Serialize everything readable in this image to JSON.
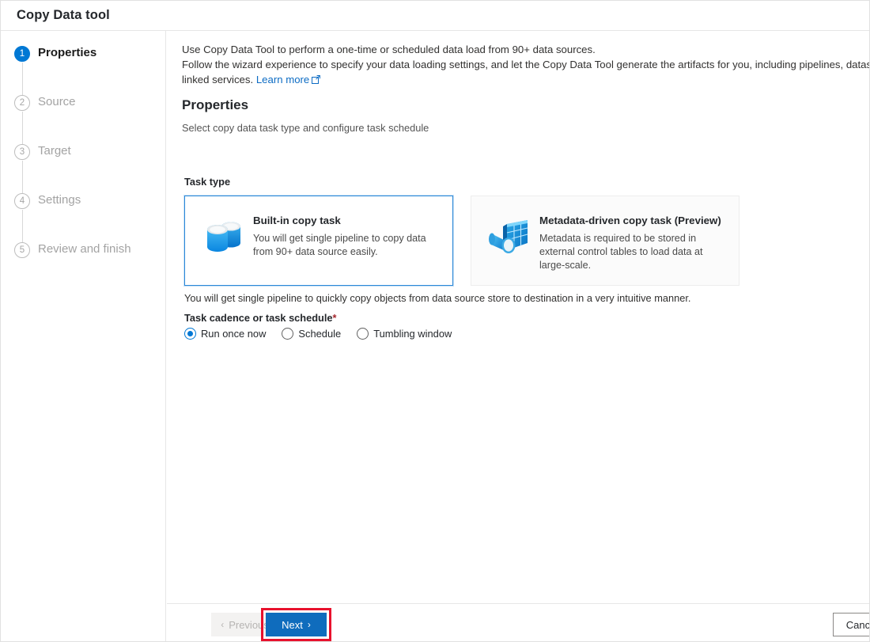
{
  "window": {
    "title": "Copy Data tool"
  },
  "sidebar": {
    "steps": [
      {
        "number": "1",
        "label": "Properties",
        "state": "active"
      },
      {
        "number": "2",
        "label": "Source",
        "state": "inactive"
      },
      {
        "number": "3",
        "label": "Target",
        "state": "inactive"
      },
      {
        "number": "4",
        "label": "Settings",
        "state": "inactive"
      },
      {
        "number": "5",
        "label": "Review and finish",
        "state": "inactive"
      }
    ]
  },
  "main": {
    "intro": {
      "line1": "Use Copy Data Tool to perform a one-time or scheduled data load from 90+ data sources.",
      "line2": "Follow the wizard experience to specify your data loading settings, and let the Copy Data Tool generate the artifacts for you, including pipelines, datasets, and",
      "line3_prefix": "linked services. ",
      "link_text": "Learn more"
    },
    "section_title": "Properties",
    "section_subtitle": "Select copy data task type and configure task schedule",
    "task_type_label": "Task type",
    "cards": [
      {
        "title": "Built-in copy task",
        "description": "You will get single pipeline to copy data from 90+ data source easily.",
        "icon": "database-stack-icon",
        "selected": true
      },
      {
        "title": "Metadata-driven copy task (Preview)",
        "description": "Metadata is required to be stored in external control tables to load data at large-scale.",
        "icon": "metadata-magnifier-table-icon",
        "selected": false
      }
    ],
    "note": "You will get single pipeline to quickly copy objects from data source store to destination in a very intuitive manner.",
    "cadence": {
      "label": "Task cadence or task schedule",
      "required_marker": "*",
      "options": [
        {
          "label": "Run once now",
          "checked": true
        },
        {
          "label": "Schedule",
          "checked": false
        },
        {
          "label": "Tumbling window",
          "checked": false
        }
      ]
    }
  },
  "footer": {
    "previous_label": "Previous",
    "next_label": "Next",
    "cancel_label": "Cancel",
    "chevron_left": "‹",
    "chevron_right": "›"
  },
  "colors": {
    "accent": "#0078d4",
    "primary_button": "#0f6cbd",
    "highlight": "#e8112d",
    "link": "#0d6cc4",
    "required": "#a4262c"
  }
}
